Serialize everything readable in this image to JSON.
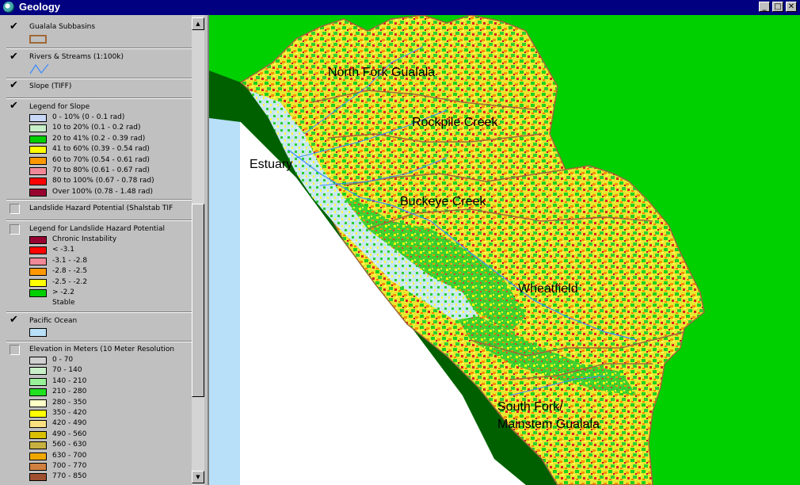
{
  "window": {
    "title": "Geology",
    "buttons": {
      "minimize": "_",
      "maximize": "□",
      "close": "✕"
    }
  },
  "toc": {
    "layers": {
      "subbasins": {
        "name": "Gualala Subbasins",
        "checked": true,
        "swatch_color": "#c8a070"
      },
      "rivers": {
        "name": "Rivers & Streams (1:100k)",
        "checked": true,
        "line_color": "#3a8cff"
      },
      "slope": {
        "name": "Slope (TIFF)",
        "checked": true
      },
      "slope_legend": {
        "name": "Legend for Slope",
        "checked": true,
        "classes": [
          {
            "label": "0 - 10% (0 - 0.1 rad)",
            "color": "#c8d8f8"
          },
          {
            "label": "10 to 20% (0.1 - 0.2 rad)",
            "color": "#c8f0c8"
          },
          {
            "label": "20 to 41% (0.2 - 0.39 rad)",
            "color": "#00d000"
          },
          {
            "label": "41 to 60% (0.39 - 0.54 rad)",
            "color": "#ffff00"
          },
          {
            "label": "60 to 70% (0.54 - 0.61 rad)",
            "color": "#ff9800"
          },
          {
            "label": "70 to 80% (0.61 - 0.67 rad)",
            "color": "#f08898"
          },
          {
            "label": "80 to 100% (0.67 - 0.78 rad)",
            "color": "#ff0000"
          },
          {
            "label": "Over 100% (0.78 - 1.48 rad)",
            "color": "#980030"
          }
        ]
      },
      "landslide": {
        "name": "Landslide Hazard Potential (Shalstab TIF",
        "checked": false
      },
      "landslide_legend": {
        "name": "Legend for Landslide Hazard Potential",
        "checked": false,
        "classes": [
          {
            "label": "Chronic Instability",
            "color": "#980030"
          },
          {
            "label": "<  -3.1",
            "color": "#ff0000"
          },
          {
            "label": "-3.1 - -2.8",
            "color": "#f08898"
          },
          {
            "label": "-2.8 - -2.5",
            "color": "#ff9800"
          },
          {
            "label": "-2.5 - -2.2",
            "color": "#ffff00"
          },
          {
            "label": "> -2.2",
            "color": "#00d000"
          },
          {
            "label": "Stable",
            "color": ""
          }
        ]
      },
      "ocean": {
        "name": "Pacific Ocean",
        "checked": true,
        "swatch_color": "#b8e0f8"
      },
      "elevation": {
        "name": "Elevation in Meters (10 Meter Resolution",
        "checked": false,
        "classes": [
          {
            "label": "0 - 70",
            "color": "#d0d0d0"
          },
          {
            "label": "70 - 140",
            "color": "#c8f0c8"
          },
          {
            "label": "140 - 210",
            "color": "#98f098"
          },
          {
            "label": "210 - 280",
            "color": "#20e020"
          },
          {
            "label": "280 - 350",
            "color": "#ffffc8"
          },
          {
            "label": "350 - 420",
            "color": "#ffff00"
          },
          {
            "label": "420 - 490",
            "color": "#f8e080"
          },
          {
            "label": "490 - 560",
            "color": "#d8c000"
          },
          {
            "label": "560 - 630",
            "color": "#c8b040"
          },
          {
            "label": "630 - 700",
            "color": "#f0a800"
          },
          {
            "label": "700 - 770",
            "color": "#d08040"
          },
          {
            "label": "770 - 850",
            "color": "#a05030"
          }
        ]
      }
    }
  },
  "scrollbar": {
    "up_arrow": "▲",
    "down_arrow": "▼"
  },
  "map": {
    "labels": {
      "north_fork": "North Fork Gualala",
      "rockpile": "Rockpile Creek",
      "estuary": "Estuary",
      "buckeye": "Buckeye Creek",
      "wheatfield": "Wheatfield",
      "south_fork_1": "South Fork/",
      "south_fork_2": "Mainstem Gualala"
    }
  }
}
